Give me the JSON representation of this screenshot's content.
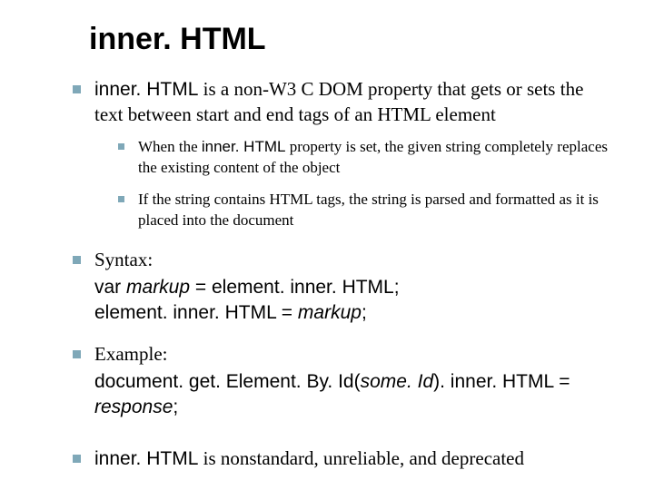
{
  "title": "inner. HTML",
  "bullets": {
    "b1_intro": "inner. HTML",
    "b1_rest": " is a non-W3 C DOM property that gets or sets the text between start and end tags of an HTML element",
    "b1a_pre": "When the ",
    "b1a_code": "inner. HTML",
    "b1a_post": " property is set, the given string completely replaces the existing content of the object",
    "b1b": "If the string contains HTML tags, the string is parsed and formatted as it is placed into the document",
    "b2_label": "Syntax:",
    "b2_line1_a": "var ",
    "b2_line1_em": "markup",
    "b2_line1_b": " = element. inner. HTML;",
    "b2_line2_a": "element. inner. HTML = ",
    "b2_line2_em": "markup",
    "b2_line2_b": ";",
    "b3_label": "Example:",
    "b3_a": "document. get. Element. By. Id",
    "b3_paren_open": "(",
    "b3_arg": "some. Id",
    "b3_paren_close": ")",
    "b3_b": ". inner. HTML = ",
    "b3_resp": "response",
    "b3_semi": ";",
    "b4_code": "inner. HTML",
    "b4_rest": " is nonstandard, unreliable, and deprecated"
  }
}
